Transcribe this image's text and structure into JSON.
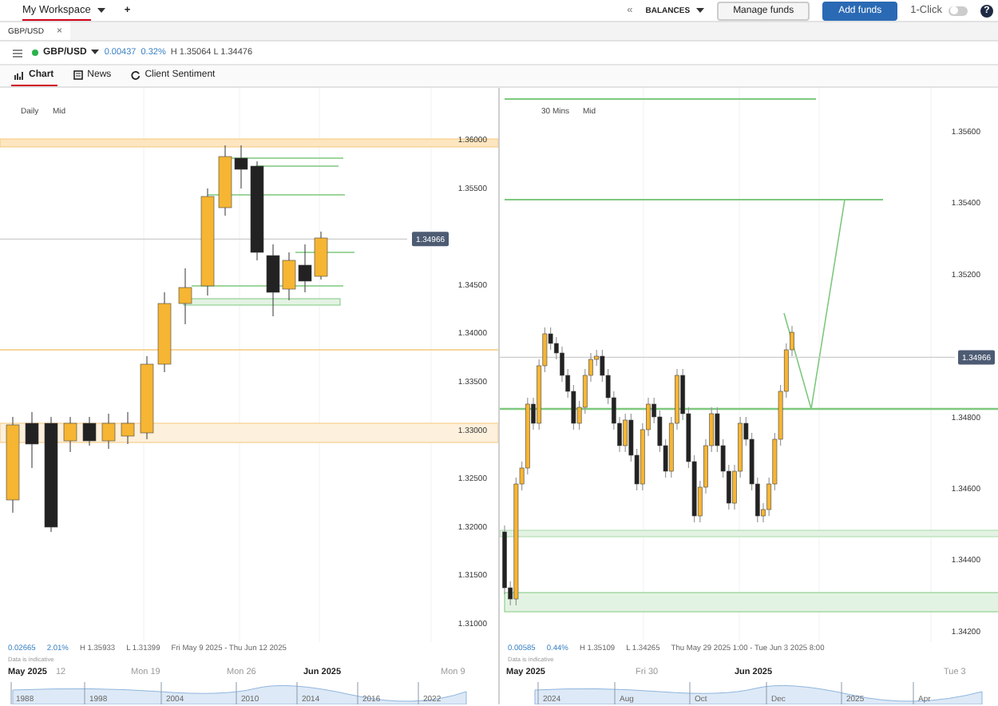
{
  "header": {
    "workspace": {
      "label": "My Workspace",
      "selected": true
    },
    "add_tab": "+",
    "collapse": "«",
    "balances": "BALANCES",
    "buttons": [
      {
        "label": "Manage funds",
        "kind": "secondary"
      },
      {
        "label": "Add funds",
        "kind": "primary"
      }
    ],
    "one_click": {
      "label": "1-Click",
      "on": false
    },
    "help": "?"
  },
  "doc_tab": {
    "label": "GBP/USD",
    "close": "×"
  },
  "instrument": {
    "symbol": "GBP/USD",
    "change": "0.00437",
    "change_pct": "0.32%",
    "high_low": "H 1.35064 L 1.34476"
  },
  "tabs": [
    {
      "label": "Chart",
      "selected": true
    },
    {
      "label": "News",
      "selected": false
    },
    {
      "label": "Client Sentiment",
      "selected": false
    }
  ],
  "charts": [
    {
      "interval": "Daily",
      "price_type": "Mid",
      "price_ticks": [
        "1.36000",
        "1.35500",
        "1.34500",
        "1.34000",
        "1.33500",
        "1.33000",
        "1.32500",
        "1.32000",
        "1.31500",
        "1.31000"
      ],
      "current_price": "1.34966",
      "stats": [
        {
          "text": "0.02665",
          "kind": "change"
        },
        {
          "text": "2.01%",
          "kind": "change"
        },
        {
          "text": "H 1.35933",
          "kind": "plain"
        },
        {
          "text": "L 1.31399",
          "kind": "plain"
        },
        {
          "text": "Fri May 9 2025 - Thu Jun 12 2025",
          "kind": "plain"
        }
      ],
      "note": "Data is indicative",
      "timeline": [
        {
          "label": "May 2025",
          "major": true
        },
        {
          "label": "12",
          "major": false
        },
        {
          "label": "Mon 19",
          "major": false
        },
        {
          "label": "Mon 26",
          "major": false
        },
        {
          "label": "Jun 2025",
          "major": true
        },
        {
          "label": "Mon 9",
          "major": false
        }
      ],
      "navigator": [
        "1988",
        "1998",
        "2004",
        "2010",
        "2014",
        "2016",
        "2022"
      ]
    },
    {
      "interval": "30 Mins",
      "price_type": "Mid",
      "price_ticks": [
        "1.35600",
        "1.35400",
        "1.35200",
        "1.34800",
        "1.34600",
        "1.34400",
        "1.34200"
      ],
      "current_price": "1.34966",
      "stats": [
        {
          "text": "0.00585",
          "kind": "change"
        },
        {
          "text": "0.44%",
          "kind": "change"
        },
        {
          "text": "H 1.35109",
          "kind": "plain"
        },
        {
          "text": "L 1.34265",
          "kind": "plain"
        },
        {
          "text": "Thu May 29 2025 1:00 - Tue Jun 3 2025 8:00",
          "kind": "plain"
        }
      ],
      "note": "Data is indicative",
      "timeline": [
        {
          "label": "May 2025",
          "major": true
        },
        {
          "label": "Fri 30",
          "major": false
        },
        {
          "label": "Jun 2025",
          "major": true
        },
        {
          "label": "Tue 3",
          "major": false
        }
      ],
      "navigator": [
        "2024",
        "Aug",
        "Oct",
        "Dec",
        "2025",
        "Apr"
      ]
    }
  ]
}
